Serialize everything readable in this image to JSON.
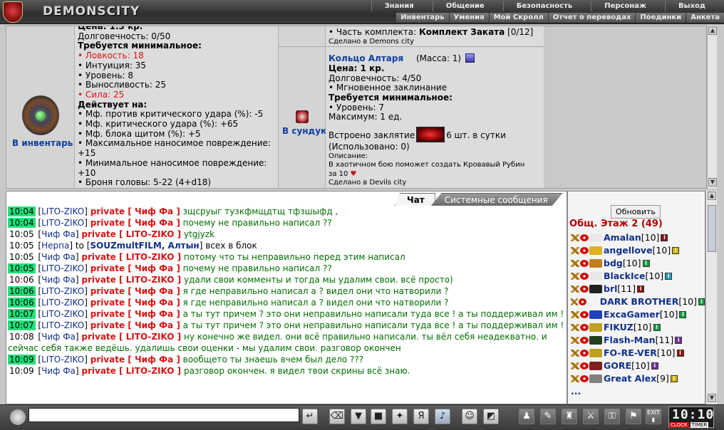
{
  "app": {
    "logo_text": "DEMONSCITY",
    "nav_main": [
      "Знания",
      "Общение",
      "Безопасность",
      "Персонаж",
      "Выход"
    ],
    "nav_sub": [
      "Инвентарь",
      "Умения",
      "Мой Скролл",
      "Отчет о переводах",
      "Поединки",
      "Анкета"
    ]
  },
  "item1": {
    "partial_top": "Цена: 1.3 кр.",
    "durability": "Долговечность: 0/50",
    "req_title": "Требуется минимальное:",
    "reqs": [
      {
        "text": "• Ловкость: 18",
        "color": "red"
      },
      {
        "text": "• Интуиция: 35",
        "color": "black"
      },
      {
        "text": "• Уровень: 8",
        "color": "black"
      },
      {
        "text": "• Выносливость: 25",
        "color": "black"
      },
      {
        "text": "• Сила: 25",
        "color": "red"
      }
    ],
    "effects_title": "Действует на:",
    "effects": [
      "• Мф. против критического удара (%): -5",
      "• Мф. критического удара (%): +65",
      "• Мф. блока щитом (%): +5",
      "• Максимальное наносимое повреждение:",
      "+15",
      "• Минимальное наносимое повреждение:",
      "+10",
      "• Броня головы: 5-22 (4+d18)"
    ],
    "action": "В инвентарь"
  },
  "item2": {
    "set_prefix": "• Часть комплекта: ",
    "set_name": "Комплект Заката",
    "set_suffix": " [0/12]",
    "made_in_top": "Сделано в Demons city",
    "name": "Кольцо Алтаря",
    "mass": "(Масса: 1)",
    "price": "Цена: 1 кр.",
    "durability": "Долговечность: 4/50",
    "instant": "• Мгновенное заклинание",
    "req_title": "Требуется минимальное:",
    "req_level": "• Уровень: 7",
    "max": "Максимум: 1 ед.",
    "spell_prefix": "Встроено заклятие",
    "spell_suffix": "6 шт. в сутки",
    "used": "(Использовано: 0)",
    "desc_title": "Описание:",
    "desc_text": "В хаотичном бою поможет создать Кровавый Рубин",
    "desc_text2": "за 10",
    "heart": "♥",
    "made_in": "Сделано в Devils city",
    "action": "В сундук"
  },
  "chat": {
    "tab_chat": "Чат",
    "tab_system": "Системные сообщения",
    "lines": [
      {
        "time": "10:04",
        "hl": true,
        "from": "LITO-ZIKO",
        "to": "Чиф Фа",
        "msg": "зщсруыг тузкфмщдтщ тфзшыфд ,",
        "msgc": "green"
      },
      {
        "time": "10:04",
        "hl": true,
        "from": "LITO-ZIKO",
        "to": "Чиф Фа",
        "msg": "почему не правильно написал ??",
        "msgc": "green"
      },
      {
        "time": "10:05",
        "hl": false,
        "from": "Чиф Фа",
        "to": "LITO-ZIKO",
        "msg": "ytgjyzk",
        "msgc": "green"
      },
      {
        "time": "10:05",
        "hl": false,
        "from": "Нерпа",
        "to_plain": "SOUZmultFILM, Алтын",
        "msg": "всех в блок",
        "msgc": "black"
      },
      {
        "time": "10:05",
        "hl": false,
        "from": "Чиф Фа",
        "to": "LITO-ZIKO",
        "msg": "потому что ты неправильно перед этим написал",
        "msgc": "green"
      },
      {
        "time": "10:05",
        "hl": true,
        "from": "LITO-ZIKO",
        "to": "Чиф Фа",
        "msg": "почему не правильно написал ??",
        "msgc": "green"
      },
      {
        "time": "10:06",
        "hl": false,
        "from": "Чиф Фа",
        "to": "LITO-ZIKO",
        "msg": "удали свои комменты и тогда мы удалим свои. всё просто)",
        "msgc": "green"
      },
      {
        "time": "10:06",
        "hl": true,
        "from": "LITO-ZIKO",
        "to": "Чиф Фа",
        "msg": "я где неправильно написал а ? видел они что натворили ?",
        "msgc": "green"
      },
      {
        "time": "10:06",
        "hl": true,
        "from": "LITO-ZIKO",
        "to": "Чиф Фа",
        "msg": "я где неправильно написал а ? видел они что натворили ?",
        "msgc": "green"
      },
      {
        "time": "10:07",
        "hl": true,
        "from": "LITO-ZIKO",
        "to": "Чиф Фа",
        "msg": "а ты тут причем ? это они неправильно написали туда все ! а ты поддерживал им !",
        "msgc": "green"
      },
      {
        "time": "10:07",
        "hl": true,
        "from": "LITO-ZIKO",
        "to": "Чиф Фа",
        "msg": "а ты тут причем ? это они неправильно написали туда все ! а ты поддерживал им !",
        "msgc": "green"
      },
      {
        "time": "10:08",
        "hl": false,
        "from": "Чиф Фа",
        "to": "LITO-ZIKO",
        "msg": "ну конечно же видел. они всё правильно написали. ты вёл себя неадекватно. и сейчас себя также ведёшь. удалишь свои оценки - мы удалим свои. разговор окончен",
        "msgc": "green"
      },
      {
        "time": "10:09",
        "hl": true,
        "from": "LITO-ZIKO",
        "to": "Чиф Фа",
        "msg": "вообщето ты знаешь вчем был дело ???",
        "msgc": "green"
      },
      {
        "time": "10:09",
        "hl": false,
        "from": "Чиф Фа",
        "to": "LITO-ZIKO",
        "msg": "разговор окончен. я видел твои скрины всё знаю.",
        "msgc": "green"
      }
    ]
  },
  "users": {
    "refresh": "Обновить",
    "room": "Общ. Этаж 2 (49)",
    "list": [
      {
        "name": "Amalan",
        "level": "[10]",
        "clan": "#eaeaea",
        "info": "#901010"
      },
      {
        "name": "angellove",
        "level": "[10]",
        "clan": "#e0b020",
        "info": "#d0b000"
      },
      {
        "name": "bdg",
        "level": "[10]",
        "clan": "#c08020",
        "info": "#10a040"
      },
      {
        "name": "BlackIce",
        "level": "[10]",
        "clan": "#e8e8e8",
        "info": "#20a0c0"
      },
      {
        "name": "brl",
        "level": "[11]",
        "clan": "#222222",
        "info": "#901010"
      },
      {
        "name": "DARK BROTHER",
        "level": "[10]",
        "clan": "",
        "info": "#10a040"
      },
      {
        "name": "ExcaGamer",
        "level": "[10]",
        "clan": "#2040c0",
        "info": "#10a040"
      },
      {
        "name": "FIKUZ",
        "level": "[10]",
        "clan": "#c0a020",
        "info": "#10a040"
      },
      {
        "name": "Flash-Man",
        "level": "[11]",
        "clan": "#204020",
        "info": "#7030a0"
      },
      {
        "name": "FO-RE-VER",
        "level": "[10]",
        "clan": "#c0a020",
        "info": "#901010"
      },
      {
        "name": "GORE",
        "level": "[10]",
        "clan": "#802020",
        "info": "#7030a0"
      },
      {
        "name": "Great Alex",
        "level": "[9]",
        "clan": "#808080",
        "info": "#d0b000"
      },
      {
        "name": "..."
      }
    ]
  },
  "toolbar": {
    "input_value": "",
    "clock_time": "10:10",
    "clock_sec": "50",
    "clock_label": "CLOCK",
    "timer_label": "TIMER",
    "exit_label": "EXIT"
  }
}
